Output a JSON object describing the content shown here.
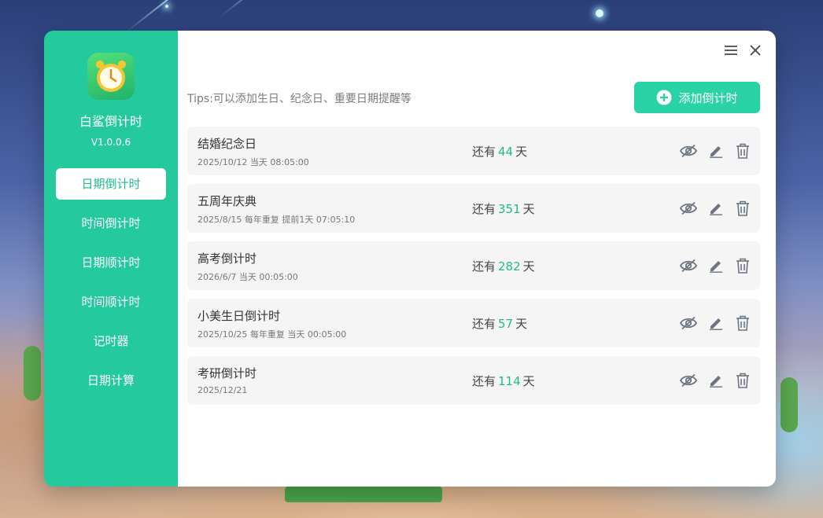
{
  "app": {
    "name": "白鲨倒计时",
    "version": "V1.0.0.6"
  },
  "colors": {
    "accent": "#25c99e",
    "accent_button": "#29d3a5",
    "number": "#21b98f",
    "icon": "#6b7480"
  },
  "sidebar": {
    "items": [
      {
        "label": "日期倒计时",
        "active": true
      },
      {
        "label": "时间倒计时",
        "active": false
      },
      {
        "label": "日期顺计时",
        "active": false
      },
      {
        "label": "时间顺计时",
        "active": false
      },
      {
        "label": "记时器",
        "active": false
      },
      {
        "label": "日期计算",
        "active": false
      }
    ]
  },
  "header": {
    "menu_icon": "menu-icon",
    "close_icon": "close-icon"
  },
  "main": {
    "tips": "Tips:可以添加生日、纪念日、重要日期提醒等",
    "add_button": "添加倒计时",
    "remain_prefix": "还有",
    "remain_suffix": "天",
    "items": [
      {
        "title": "结婚纪念日",
        "subtitle": "2025/10/12 当天 08:05:00",
        "days": "44"
      },
      {
        "title": "五周年庆典",
        "subtitle": "2025/8/15 每年重复 提前1天 07:05:10",
        "days": "351"
      },
      {
        "title": "高考倒计时",
        "subtitle": "2026/6/7 当天 00:05:00",
        "days": "282"
      },
      {
        "title": "小美生日倒计时",
        "subtitle": "2025/10/25 每年重复 当天 00:05:00",
        "days": "57"
      },
      {
        "title": "考研倒计时",
        "subtitle": "2025/12/21",
        "days": "114"
      }
    ]
  }
}
